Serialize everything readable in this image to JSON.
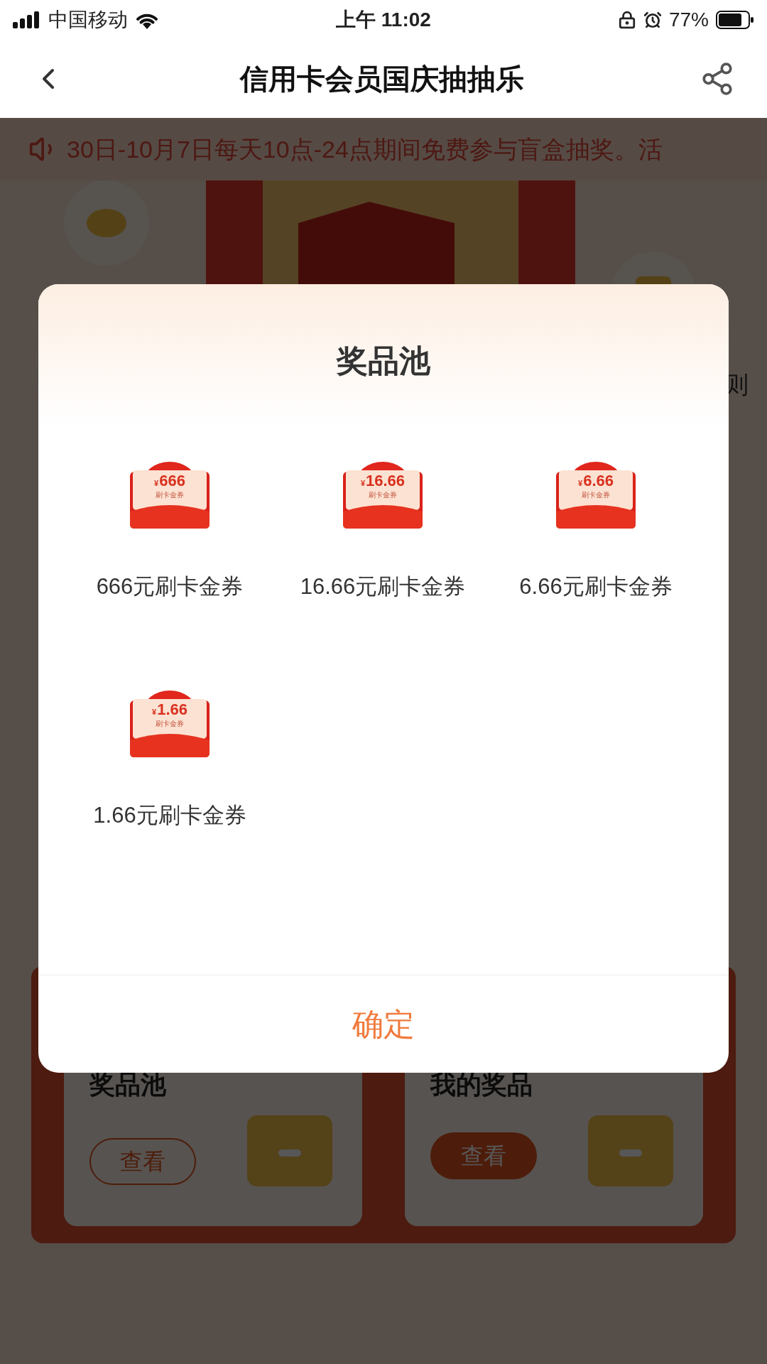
{
  "status_bar": {
    "carrier": "中国移动",
    "time": "上午 11:02",
    "battery": "77%"
  },
  "nav": {
    "title": "信用卡会员国庆抽抽乐"
  },
  "notice": {
    "text": "30日-10月7日每天10点-24点期间免费参与盲盒抽奖。活"
  },
  "rules_fragment": "则",
  "cards": [
    {
      "title": "奖品池",
      "button": "查看",
      "kind": "outline"
    },
    {
      "title": "我的奖品",
      "button": "查看",
      "kind": "filled"
    }
  ],
  "dialog": {
    "title": "奖品池",
    "prizes": [
      {
        "currency": "¥",
        "amount": "666",
        "caption": "刷卡金券",
        "label": "666元刷卡金券"
      },
      {
        "currency": "¥",
        "amount": "16.66",
        "caption": "刷卡金券",
        "label": "16.66元刷卡金券"
      },
      {
        "currency": "¥",
        "amount": "6.66",
        "caption": "刷卡金券",
        "label": "6.66元刷卡金券"
      },
      {
        "currency": "¥",
        "amount": "1.66",
        "caption": "刷卡金券",
        "label": "1.66元刷卡金券"
      }
    ],
    "confirm": "确定"
  }
}
